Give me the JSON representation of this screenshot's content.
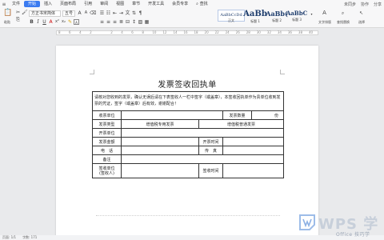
{
  "menu": {
    "items": [
      "文件",
      "开始",
      "插入",
      "页面布局",
      "引用",
      "审阅",
      "视图",
      "章节",
      "开发工具",
      "会员专享"
    ],
    "active": "开始",
    "search": "查找",
    "right": [
      "未同步",
      "协作",
      "分享"
    ]
  },
  "ribbon": {
    "paste": "粘贴",
    "font_name": "方正书宋简体",
    "font_size": "五号",
    "format_painter": "格式刷",
    "styles": [
      {
        "sample": "AaBbCcDd",
        "label": "正文"
      },
      {
        "sample": "AaBb",
        "label": "标题 1"
      },
      {
        "sample": "AaBb(",
        "label": "标题 2"
      },
      {
        "sample": "AaBbC",
        "label": "标题 3"
      }
    ],
    "text_tools": "文字排版",
    "find_replace": "查找替换",
    "select": "选择"
  },
  "ruler": {
    "numbers": [
      "8",
      "6",
      "4",
      "2",
      "",
      "2",
      "4",
      "6",
      "8",
      "10",
      "12",
      "14",
      "16",
      "18",
      "20",
      "22",
      "24",
      "26",
      "28",
      "30",
      "32",
      "34",
      "36",
      "38",
      "40"
    ]
  },
  "document": {
    "title": "发票签收回执单",
    "notice": "请核对您收到的发票，确认无误后请在下表签收人一栏中签字（或盖章），本签收回执单作为贵单位收到发票的凭证，签字（或盖章）后有效，谢谢配合！",
    "labels": {
      "recv_unit": "收票单位",
      "invoice_count": "发票数量",
      "unit_fen": "份",
      "invoice_type": "发票类型",
      "vat_special": "增值税专用发票",
      "vat_normal": "增值税普通发票",
      "issuer": "开票单位",
      "amount": "发票金额",
      "issue_time": "开票时间",
      "phone": "电　话",
      "fax": "传　真",
      "remark": "备注",
      "signer": "签收单位\n(签收人)",
      "sign_time": "签收时间"
    }
  },
  "status": {
    "page": "页面: 1/1",
    "words": "字数: 171"
  },
  "watermark": {
    "brand": "WPS 学",
    "tagline": "Office 技巧学"
  },
  "colors": {
    "accent": "#3b7bf0",
    "wps_logo": "#5b8fd9",
    "heading_blue": "#1f3e6e"
  }
}
